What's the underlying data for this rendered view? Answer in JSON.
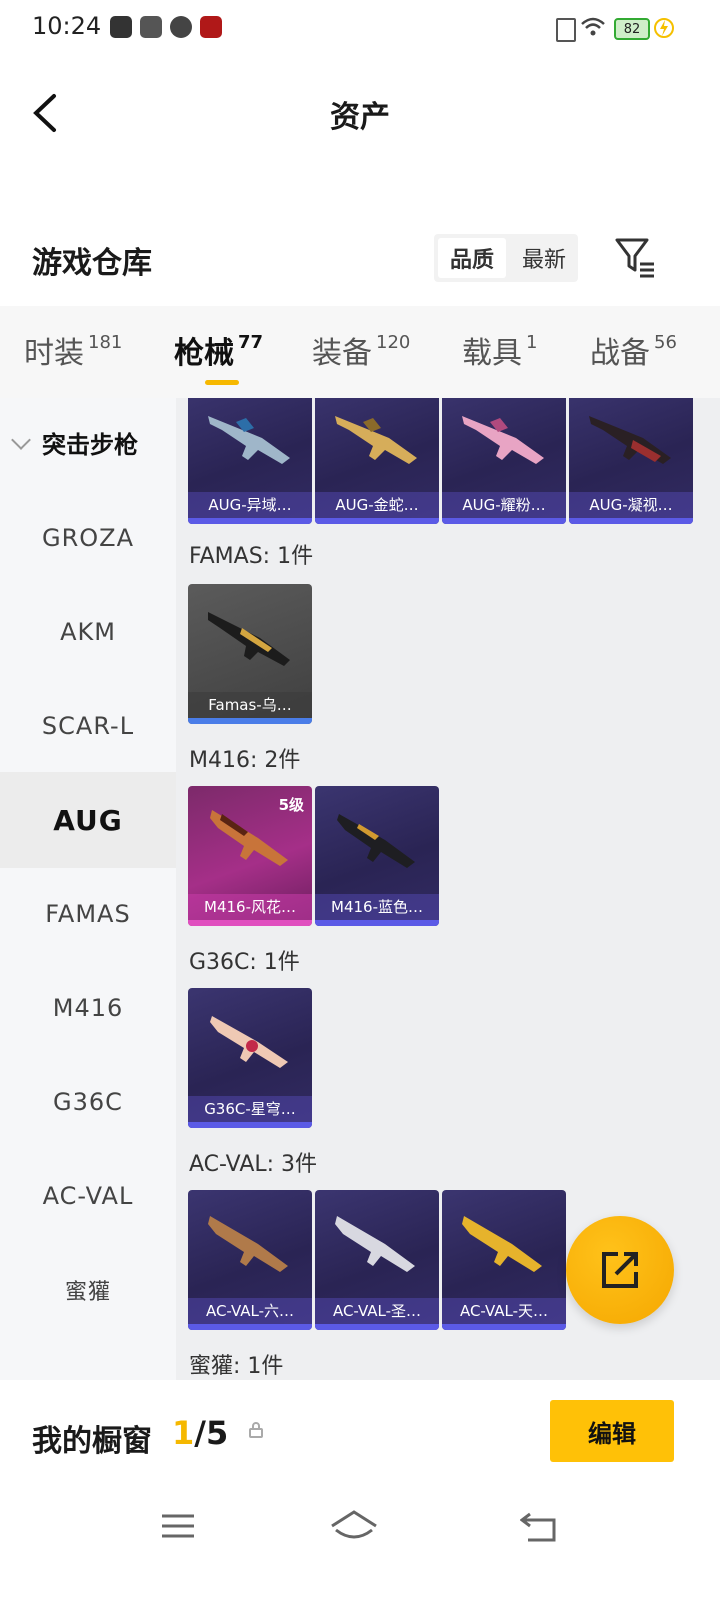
{
  "status_bar": {
    "time": "10:24",
    "battery": "82"
  },
  "header": {
    "title": "资产"
  },
  "warehouse": {
    "title": "游戏仓库",
    "sort_options": [
      "品质",
      "最新"
    ],
    "sort_selected": "品质"
  },
  "tabs": [
    {
      "label": "时装",
      "count": "181"
    },
    {
      "label": "枪械",
      "count": "77",
      "active": true
    },
    {
      "label": "装备",
      "count": "120"
    },
    {
      "label": "载具",
      "count": "1"
    },
    {
      "label": "战备",
      "count": "56"
    }
  ],
  "sidebar": {
    "category": "突击步枪",
    "items": [
      "GROZA",
      "AKM",
      "SCAR-L",
      "AUG",
      "FAMAS",
      "M416",
      "G36C",
      "AC-VAL",
      "蜜獾"
    ],
    "active": "AUG"
  },
  "groups": [
    {
      "title": "",
      "items": [
        {
          "name": "AUG-异域…"
        },
        {
          "name": "AUG-金蛇…"
        },
        {
          "name": "AUG-耀粉…"
        },
        {
          "name": "AUG-凝视…"
        }
      ]
    },
    {
      "title": "FAMAS: 1件",
      "items": [
        {
          "name": "Famas-乌…"
        }
      ]
    },
    {
      "title": "M416: 2件",
      "items": [
        {
          "name": "M416-风花…",
          "level": "5级"
        },
        {
          "name": "M416-蓝色…"
        }
      ]
    },
    {
      "title": "G36C: 1件",
      "items": [
        {
          "name": "G36C-星穹…"
        }
      ]
    },
    {
      "title": "AC-VAL: 3件",
      "items": [
        {
          "name": "AC-VAL-六…"
        },
        {
          "name": "AC-VAL-圣…"
        },
        {
          "name": "AC-VAL-天…"
        }
      ]
    },
    {
      "title": "蜜獾: 1件",
      "items": []
    }
  ],
  "showcase": {
    "label": "我的橱窗",
    "current": "1",
    "total": "/5",
    "edit_label": "编辑"
  },
  "colors": {
    "accent": "#f5b800",
    "card_bg": "#2a2454",
    "card_bar": "#5b5ae6"
  },
  "icons": [
    "back-arrow-icon",
    "filter-icon",
    "share-out-icon",
    "lock-icon",
    "menu-icon",
    "home-icon",
    "back-icon"
  ]
}
